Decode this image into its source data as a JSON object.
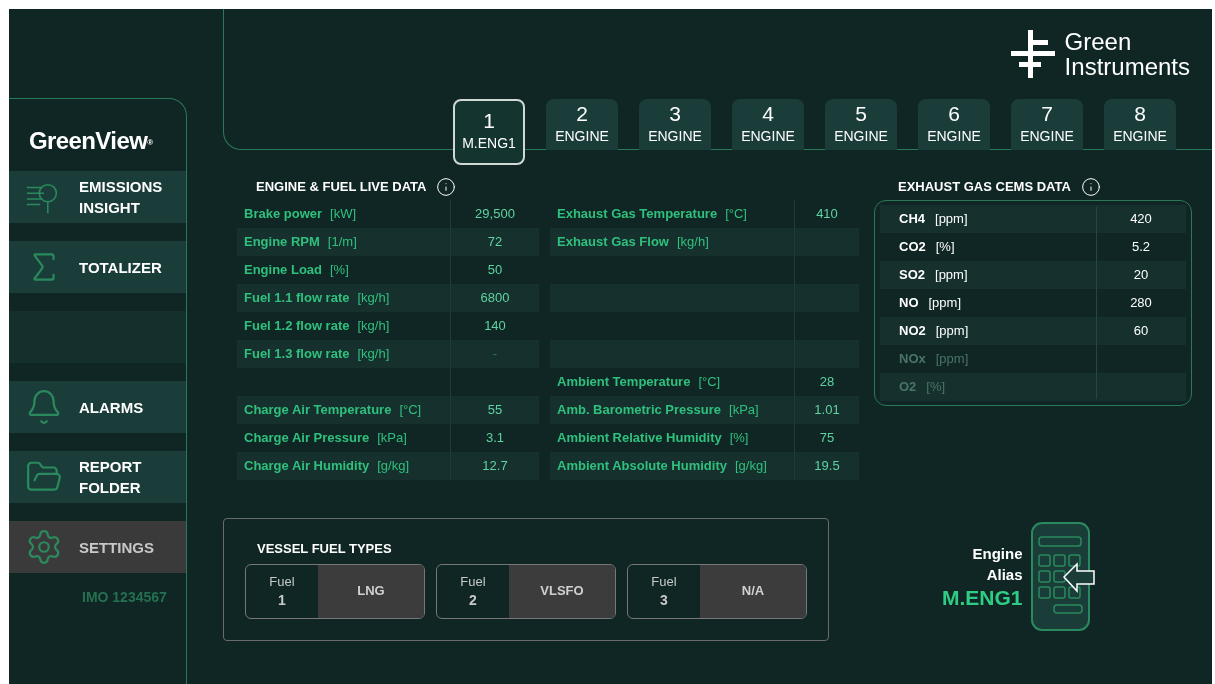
{
  "brand": {
    "logo_lines": [
      "Green",
      "Instruments"
    ]
  },
  "sidebar": {
    "title": "GreenView",
    "title_mark": "®",
    "items": [
      {
        "kind": "emissions",
        "label_lines": [
          "EMISSIONS",
          "INSIGHT"
        ],
        "disabled": false
      },
      {
        "kind": "totalizer",
        "label_lines": [
          "TOTALIZER"
        ],
        "disabled": false
      },
      {
        "kind": "blank",
        "disabled": false
      },
      {
        "kind": "alarms",
        "label_lines": [
          "ALARMS"
        ],
        "disabled": false
      },
      {
        "kind": "report",
        "label_lines": [
          "REPORT",
          "FOLDER"
        ],
        "disabled": false
      },
      {
        "kind": "settings",
        "label_lines": [
          "SETTINGS"
        ],
        "disabled": true
      }
    ],
    "imo": "IMO 1234567"
  },
  "tabs": [
    {
      "number": "1",
      "label": "M.ENG1",
      "selected": true
    },
    {
      "number": "2",
      "label": "ENGINE",
      "selected": false
    },
    {
      "number": "3",
      "label": "ENGINE",
      "selected": false
    },
    {
      "number": "4",
      "label": "ENGINE",
      "selected": false
    },
    {
      "number": "5",
      "label": "ENGINE",
      "selected": false
    },
    {
      "number": "6",
      "label": "ENGINE",
      "selected": false
    },
    {
      "number": "7",
      "label": "ENGINE",
      "selected": false
    },
    {
      "number": "8",
      "label": "ENGINE",
      "selected": false
    }
  ],
  "engine_data": {
    "title": "ENGINE & FUEL LIVE DATA",
    "left_rows": [
      {
        "kind": "reading",
        "label": "Brake power",
        "unit": "[kW]",
        "value": "29,500"
      },
      {
        "kind": "reading",
        "label": "Engine RPM",
        "unit": "[1/m]",
        "value": "72"
      },
      {
        "kind": "reading",
        "label": "Engine Load",
        "unit": "[%]",
        "value": "50"
      },
      {
        "kind": "reading",
        "label": "Fuel 1.1 flow rate",
        "unit": "[kg/h]",
        "value": "6800"
      },
      {
        "kind": "reading",
        "label": "Fuel 1.2 flow rate",
        "unit": "[kg/h]",
        "value": "140"
      },
      {
        "kind": "reading",
        "label": "Fuel 1.3 flow rate",
        "unit": "[kg/h]",
        "value": "-"
      },
      {
        "kind": "blank"
      },
      {
        "kind": "reading",
        "label": "Charge Air Temperature",
        "unit": "[°C]",
        "value": "55"
      },
      {
        "kind": "reading",
        "label": "Charge Air Pressure",
        "unit": "[kPa]",
        "value": "3.1"
      },
      {
        "kind": "reading",
        "label": "Charge Air Humidity",
        "unit": "[g/kg]",
        "value": "12.7"
      }
    ],
    "right_rows": [
      {
        "kind": "reading",
        "label": "Exhaust Gas Temperature",
        "unit": "[°C]",
        "value": "410"
      },
      {
        "kind": "reading",
        "label": "Exhaust Gas Flow",
        "unit": "[kg/h]"
      },
      {
        "kind": "blank"
      },
      {
        "kind": "blank"
      },
      {
        "kind": "blank"
      },
      {
        "kind": "blank"
      },
      {
        "kind": "reading",
        "label": "Ambient Temperature",
        "unit": "[°C]",
        "value": "28"
      },
      {
        "kind": "reading",
        "label": "Amb. Barometric Pressure",
        "unit": "[kPa]",
        "value": "1.01"
      },
      {
        "kind": "reading",
        "label": "Ambient Relative Humidity",
        "unit": "[%]",
        "value": "75"
      },
      {
        "kind": "reading",
        "label": "Ambient Absolute Humidity",
        "unit": "[g/kg]",
        "value": "19.5"
      }
    ]
  },
  "cems": {
    "title": "EXHAUST GAS CEMS DATA",
    "rows": [
      {
        "name": "CH4",
        "unit": "[ppm]",
        "value": "420",
        "disabled": false
      },
      {
        "name": "CO2",
        "unit": "[%]",
        "value": "5.2",
        "disabled": false
      },
      {
        "name": "SO2",
        "unit": "[ppm]",
        "value": "20",
        "disabled": false
      },
      {
        "name": "NO",
        "unit": "[ppm]",
        "value": "280",
        "disabled": false
      },
      {
        "name": "NO2",
        "unit": "[ppm]",
        "value": "60",
        "disabled": false
      },
      {
        "name": "NOx",
        "unit": "[ppm]",
        "disabled": true
      },
      {
        "name": "O2",
        "unit": "[%]",
        "disabled": true
      }
    ]
  },
  "fuel_types": {
    "title": "VESSEL FUEL TYPES",
    "fuels": [
      {
        "label": "Fuel",
        "number": "1",
        "type": "LNG"
      },
      {
        "label": "Fuel",
        "number": "2",
        "type": "VLSFO"
      },
      {
        "label": "Fuel",
        "number": "3",
        "type": "N/A"
      }
    ]
  },
  "alias": {
    "label_lines": [
      "Engine",
      "Alias"
    ],
    "value": "M.ENG1"
  }
}
